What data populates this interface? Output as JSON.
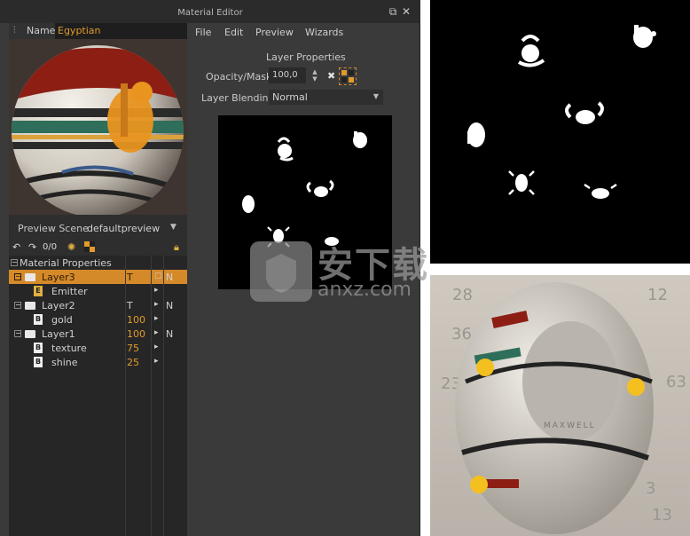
{
  "window": {
    "title": "Material Editor"
  },
  "name_field": {
    "label": "Name",
    "value": "Egyptian"
  },
  "preview_scene": {
    "label": "Preview Scene",
    "value": "defaultpreview"
  },
  "toolbar": {
    "counter": "0/0"
  },
  "tree": {
    "root_label": "Material Properties",
    "rows": [
      {
        "name": "Layer3",
        "c1": "T",
        "c2": "▢",
        "c3": "N"
      },
      {
        "name": "Emitter",
        "c1": "",
        "c2": "▸",
        "c3": ""
      },
      {
        "name": "Layer2",
        "c1": "T",
        "c2": "▸",
        "c3": "N"
      },
      {
        "name": "gold",
        "c1": "100",
        "c2": "▸",
        "c3": ""
      },
      {
        "name": "Layer1",
        "c1": "100",
        "c2": "▸",
        "c3": "N"
      },
      {
        "name": "texture",
        "c1": "75",
        "c2": "▸",
        "c3": ""
      },
      {
        "name": "shine",
        "c1": "25",
        "c2": "▸",
        "c3": ""
      }
    ]
  },
  "menu": [
    "File",
    "Edit",
    "Preview",
    "Wizards"
  ],
  "layer_properties": {
    "title": "Layer Properties",
    "opacity_label": "Opacity/Mask",
    "opacity_value": "100,0",
    "blending_label": "Layer Blending",
    "blending_value": "Normal"
  },
  "watermark": {
    "text": "安下载",
    "url": "anxz.com"
  },
  "render_numbers": [
    "28",
    "12",
    "36",
    "63",
    "23",
    "3",
    "13"
  ],
  "render_brand": "MAXWELL",
  "colors": {
    "accent": "#d58a2a",
    "name_value": "#e19b2c",
    "panel": "#3a3a3a"
  }
}
